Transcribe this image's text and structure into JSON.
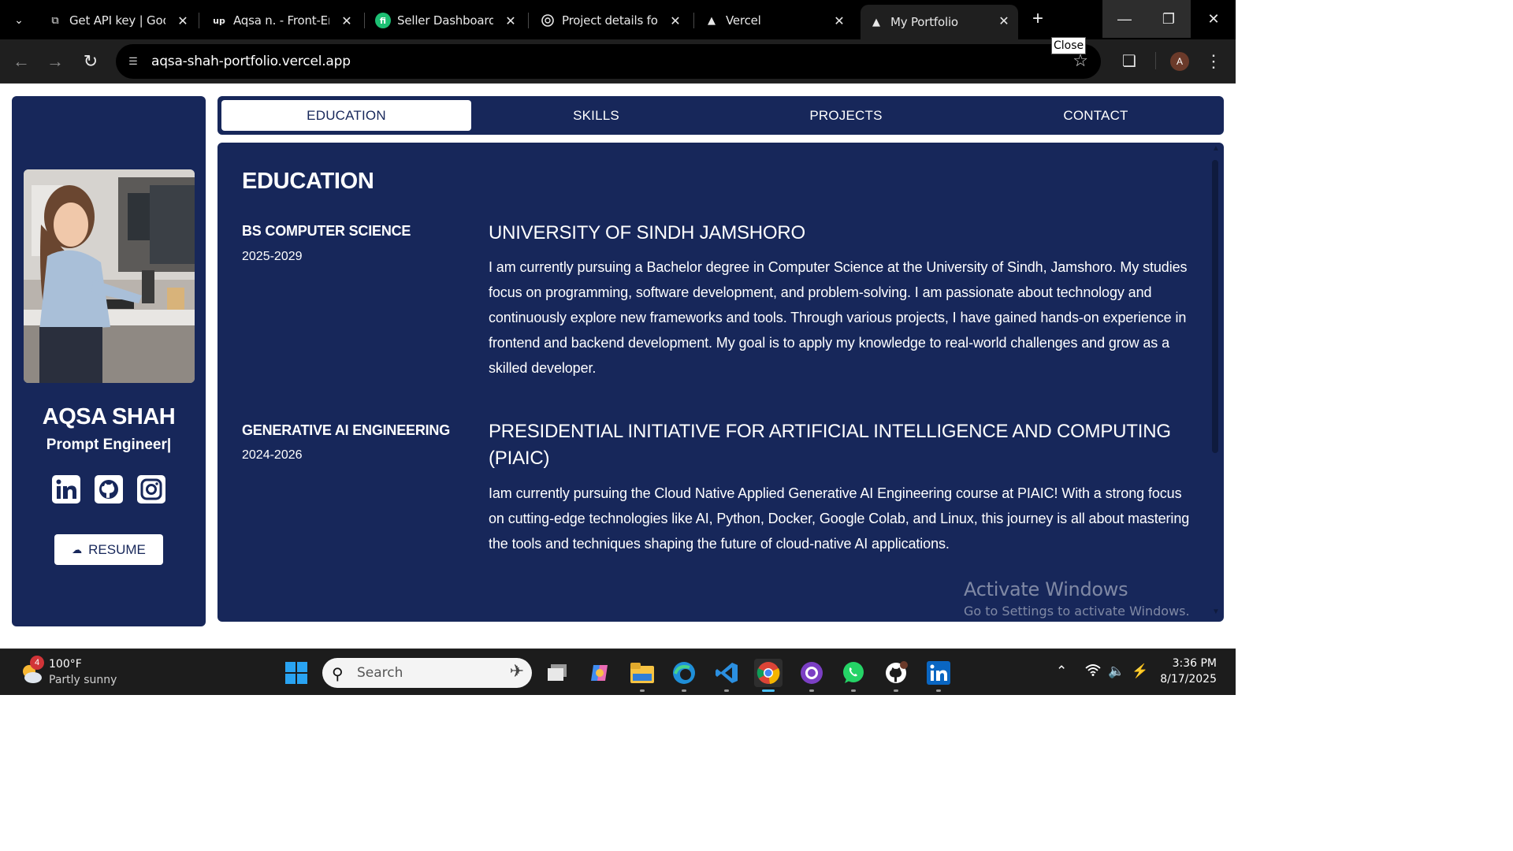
{
  "browser": {
    "tabs": [
      {
        "title": "Get API key | Goog",
        "icon": "external-page-icon"
      },
      {
        "title": "Aqsa n. - Front-End",
        "icon": "upwork-icon"
      },
      {
        "title": "Seller Dashboard",
        "icon": "fiverr-icon"
      },
      {
        "title": "Project details form",
        "icon": "openai-icon"
      },
      {
        "title": "Vercel",
        "icon": "vercel-icon"
      },
      {
        "title": "My Portfolio",
        "icon": "vercel-icon",
        "active": true
      }
    ],
    "url": "aqsa-shah-portfolio.vercel.app",
    "tooltip": "Close",
    "profile_initial": "A"
  },
  "sidebar": {
    "name": "AQSA SHAH",
    "role": "Prompt Engineer|",
    "socials": [
      "linkedin-icon",
      "github-icon",
      "instagram-icon"
    ],
    "resume_label": "RESUME"
  },
  "nav": {
    "tabs": [
      "EDUCATION",
      "SKILLS",
      "PROJECTS",
      "CONTACT"
    ],
    "active": "EDUCATION"
  },
  "education": {
    "title": "EDUCATION",
    "entries": [
      {
        "degree": "BS COMPUTER SCIENCE",
        "years": "2025-2029",
        "institution": "UNIVERSITY OF SINDH JAMSHORO",
        "description": "I am currently pursuing a Bachelor degree in Computer Science at the University of Sindh, Jamshoro. My studies focus on programming, software development, and problem-solving. I am passionate about technology and continuously explore new frameworks and tools. Through various projects, I have gained hands-on experience in frontend and backend development. My goal is to apply my knowledge to real-world challenges and grow as a skilled developer."
      },
      {
        "degree": "GENERATIVE AI ENGINEERING",
        "years": "2024-2026",
        "institution": "PRESIDENTIAL INITIATIVE FOR ARTIFICIAL INTELLIGENCE AND COMPUTING (PIAIC)",
        "description": "Iam currently pursuing the Cloud Native Applied Generative AI Engineering course at PIAIC! With a strong focus on cutting-edge technologies like AI, Python, Docker, Google Colab, and Linux, this journey is all about mastering the tools and techniques shaping the future of cloud-native AI applications."
      }
    ]
  },
  "watermark": {
    "title": "Activate Windows",
    "subtitle": "Go to Settings to activate Windows."
  },
  "taskbar": {
    "weather_temp": "100°F",
    "weather_cond": "Partly sunny",
    "weather_badge": "4",
    "search_placeholder": "Search",
    "time": "3:36 PM",
    "date": "8/17/2025"
  },
  "colors": {
    "navy": "#17275a",
    "white": "#ffffff",
    "chrome_dark": "#000000",
    "toolbar": "#1f1f1f"
  }
}
